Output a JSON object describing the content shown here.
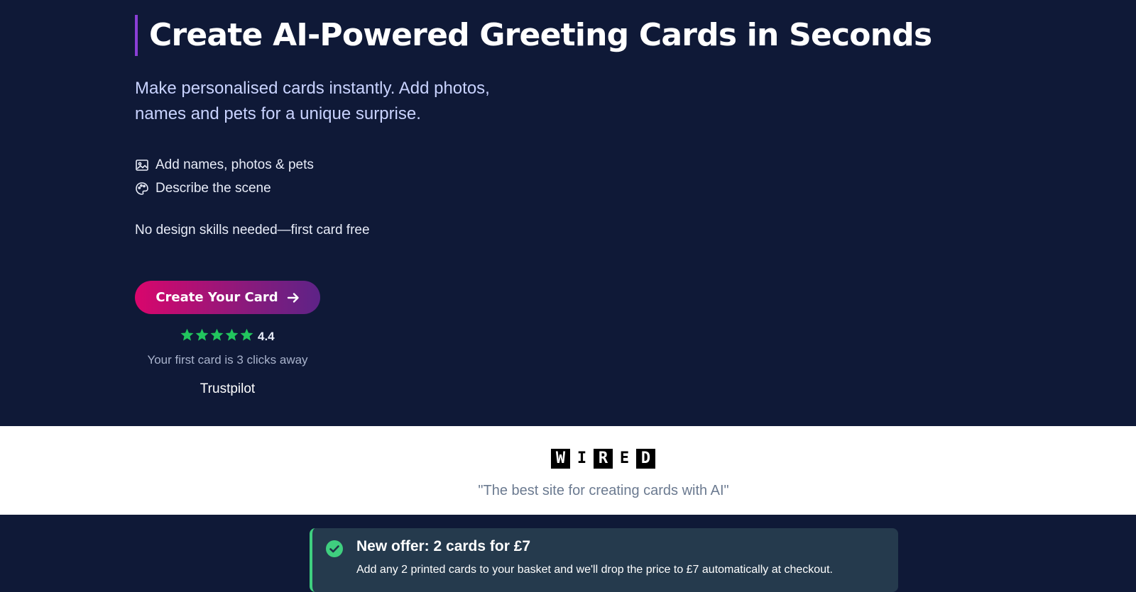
{
  "hero": {
    "title": "Create AI-Powered Greeting Cards in Seconds",
    "subtitle": "Make personalised cards instantly. Add photos, names and pets for a unique surprise.",
    "features": [
      {
        "icon": "image-icon",
        "label": "Add names, photos & pets"
      },
      {
        "icon": "palette-icon",
        "label": "Describe the scene"
      }
    ],
    "tagline": "No design skills needed—first card free",
    "cta_label": "Create Your Card",
    "rating": {
      "stars": 5,
      "value": "4.4",
      "clicks_text": "Your first card is 3 clicks away",
      "provider": "Trustpilot"
    }
  },
  "press": {
    "logo_text": "WIRED",
    "quote": "\"The best site for creating cards with AI\""
  },
  "offer": {
    "title": "New offer: 2 cards for £7",
    "text": "Add any 2 printed cards to your basket and we'll drop the price to £7 automatically at checkout."
  },
  "colors": {
    "background": "#0f1937",
    "accent_bar": "#8a3fd6",
    "cta_gradient_start": "#d9066c",
    "cta_gradient_end": "#5d2387",
    "star_green": "#22c55e",
    "offer_bg": "#253a4d",
    "offer_accent": "#3fcf7f"
  }
}
